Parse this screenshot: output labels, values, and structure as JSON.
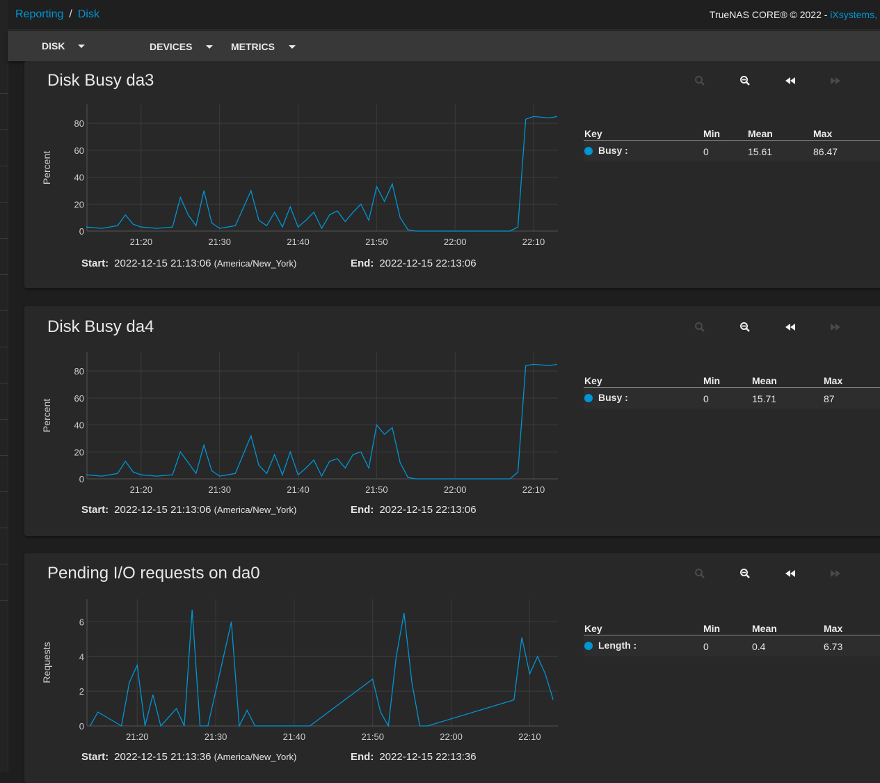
{
  "breadcrumb": {
    "reporting": "Reporting",
    "separator": "/",
    "disk": "Disk"
  },
  "header": {
    "copyright_text": "TrueNAS CORE® © 2022 - ",
    "copyright_link": "iXsystems,"
  },
  "toolbar": {
    "disk_label": "DISK",
    "devices_label": "DEVICES",
    "metrics_label": "METRICS"
  },
  "icons": {
    "zoom_in": "zoom-in-icon",
    "zoom_out": "zoom-out-icon",
    "back": "rewind-icon",
    "forward": "fast-forward-icon"
  },
  "colors": {
    "accent": "#0095d5",
    "card": "#282828",
    "background": "#1e1e1e"
  },
  "cards": [
    {
      "title": "Disk Busy da3",
      "ylabel": "Percent",
      "start_label": "Start:",
      "start_value": "2022-12-15 21:13:06",
      "timezone": "(America/New_York)",
      "end_label": "End:",
      "end_value": "2022-12-15 22:13:06",
      "legend": {
        "key": "Key",
        "min": "Min",
        "mean": "Mean",
        "max": "Max",
        "series": "Busy :",
        "min_value": "0",
        "mean_value": "15.61",
        "max_value": "86.47"
      }
    },
    {
      "title": "Disk Busy da4",
      "ylabel": "Percent",
      "start_label": "Start:",
      "start_value": "2022-12-15 21:13:06",
      "timezone": "(America/New_York)",
      "end_label": "End:",
      "end_value": "2022-12-15 22:13:06",
      "legend": {
        "key": "Key",
        "min": "Min",
        "mean": "Mean",
        "max": "Max",
        "series": "Busy :",
        "min_value": "0",
        "mean_value": "15.71",
        "max_value": "87"
      }
    },
    {
      "title": "Pending I/O requests on da0",
      "ylabel": "Requests",
      "start_label": "Start:",
      "start_value": "2022-12-15 21:13:36",
      "timezone": "(America/New_York)",
      "end_label": "End:",
      "end_value": "2022-12-15 22:13:36",
      "legend": {
        "key": "Key",
        "min": "Min",
        "mean": "Mean",
        "max": "Max",
        "series": "Length :",
        "min_value": "0",
        "mean_value": "0.4",
        "max_value": "6.73"
      }
    }
  ],
  "chart_data": [
    {
      "type": "line",
      "ylabel": "Percent",
      "xlim": [
        "21:13:06",
        "22:13:06"
      ],
      "ylim": [
        0,
        94
      ],
      "xticks": [
        "21:20",
        "21:30",
        "21:40",
        "21:50",
        "22:00",
        "22:10"
      ],
      "yticks": [
        0,
        20,
        40,
        60,
        80
      ],
      "grid": true,
      "series": [
        {
          "name": "Busy",
          "x": [
            "21:13",
            "21:15",
            "21:17",
            "21:18",
            "21:19",
            "21:20",
            "21:22",
            "21:24",
            "21:25",
            "21:26",
            "21:27",
            "21:28",
            "21:29",
            "21:30",
            "21:31",
            "21:32",
            "21:34",
            "21:35",
            "21:36",
            "21:37",
            "21:38",
            "21:39",
            "21:40",
            "21:41",
            "21:42",
            "21:43",
            "21:44",
            "21:45",
            "21:46",
            "21:47",
            "21:48",
            "21:49",
            "21:50",
            "21:51",
            "21:52",
            "21:53",
            "21:54",
            "21:55",
            "21:56",
            "21:58",
            "22:00",
            "22:02",
            "22:04",
            "22:06",
            "22:07",
            "22:08",
            "22:09",
            "22:10",
            "22:12",
            "22:13"
          ],
          "y": [
            3,
            2,
            4,
            12,
            5,
            3,
            2,
            3,
            25,
            12,
            4,
            30,
            6,
            2,
            3,
            4,
            30,
            8,
            4,
            14,
            3,
            18,
            3,
            8,
            14,
            2,
            12,
            15,
            7,
            14,
            20,
            8,
            33,
            22,
            35,
            10,
            1,
            0,
            0,
            0,
            0,
            0,
            0,
            0,
            0,
            3,
            83,
            85,
            84,
            85
          ]
        }
      ]
    },
    {
      "type": "line",
      "ylabel": "Percent",
      "xlim": [
        "21:13:06",
        "22:13:06"
      ],
      "ylim": [
        0,
        94
      ],
      "xticks": [
        "21:20",
        "21:30",
        "21:40",
        "21:50",
        "22:00",
        "22:10"
      ],
      "yticks": [
        0,
        20,
        40,
        60,
        80
      ],
      "grid": true,
      "series": [
        {
          "name": "Busy",
          "x": [
            "21:13",
            "21:15",
            "21:17",
            "21:18",
            "21:19",
            "21:20",
            "21:22",
            "21:24",
            "21:25",
            "21:26",
            "21:27",
            "21:28",
            "21:29",
            "21:30",
            "21:31",
            "21:32",
            "21:34",
            "21:35",
            "21:36",
            "21:37",
            "21:38",
            "21:39",
            "21:40",
            "21:41",
            "21:42",
            "21:43",
            "21:44",
            "21:45",
            "21:46",
            "21:47",
            "21:48",
            "21:49",
            "21:50",
            "21:51",
            "21:52",
            "21:53",
            "21:54",
            "21:55",
            "21:56",
            "21:58",
            "22:00",
            "22:02",
            "22:04",
            "22:06",
            "22:07",
            "22:08",
            "22:09",
            "22:10",
            "22:12",
            "22:13"
          ],
          "y": [
            3,
            2,
            4,
            13,
            5,
            3,
            2,
            3,
            20,
            12,
            4,
            25,
            6,
            2,
            3,
            4,
            32,
            10,
            4,
            18,
            3,
            20,
            3,
            8,
            14,
            2,
            13,
            15,
            8,
            18,
            20,
            8,
            40,
            33,
            38,
            12,
            1,
            0,
            0,
            0,
            0,
            0,
            0,
            0,
            0,
            5,
            84,
            85,
            84,
            85
          ]
        }
      ]
    },
    {
      "type": "line",
      "ylabel": "Requests",
      "xlim": [
        "21:13:36",
        "22:13:36"
      ],
      "ylim": [
        0,
        7.3
      ],
      "xticks": [
        "21:20",
        "21:30",
        "21:40",
        "21:50",
        "22:00",
        "22:10"
      ],
      "yticks": [
        0,
        2,
        4,
        6
      ],
      "grid": true,
      "series": [
        {
          "name": "Length",
          "x": [
            "21:14",
            "21:15",
            "21:18",
            "21:19",
            "21:20",
            "21:21",
            "21:22",
            "21:23",
            "21:25",
            "21:26",
            "21:27",
            "21:28",
            "21:29",
            "21:32",
            "21:33",
            "21:34",
            "21:35",
            "21:36",
            "21:42",
            "21:50",
            "21:51",
            "21:52",
            "21:53",
            "21:54",
            "21:55",
            "21:56",
            "21:57",
            "22:08",
            "22:09",
            "22:10",
            "22:11",
            "22:12",
            "22:13"
          ],
          "y": [
            0,
            0.8,
            0,
            2.5,
            3.5,
            0,
            1.8,
            0,
            1,
            0,
            6.7,
            0,
            0,
            6,
            0,
            0.9,
            0,
            0,
            0,
            2.7,
            0.8,
            0,
            4,
            6.5,
            2.5,
            0,
            0,
            1.5,
            5.1,
            3,
            4,
            3,
            1.5
          ]
        }
      ]
    }
  ]
}
